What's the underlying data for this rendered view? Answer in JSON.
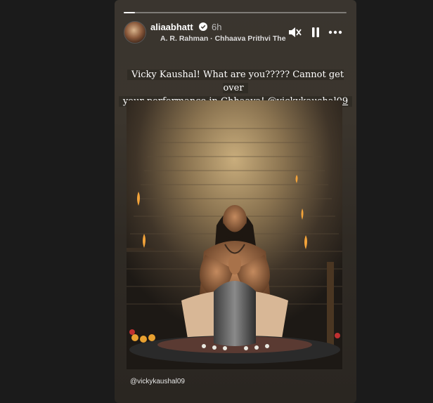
{
  "story": {
    "progress": 0.05,
    "username": "aliaabhatt",
    "time": "6h",
    "music": "A. R. Rahman · Chhaava Prithvi The",
    "caption_line1": "Vicky Kaushal! What are you????? Cannot get over",
    "caption_line2_text": "your performance in Chhaava! ",
    "caption_mention": "@vickykaushal09",
    "tag": "@vickykaushal09"
  },
  "icons": {
    "mute": "mute-icon",
    "pause": "pause-icon",
    "more": "more-icon",
    "verified": "verified-icon"
  },
  "colors": {
    "background": "#1b1b1b",
    "story_bg": "#3a352f",
    "verified": "#ffffff"
  }
}
